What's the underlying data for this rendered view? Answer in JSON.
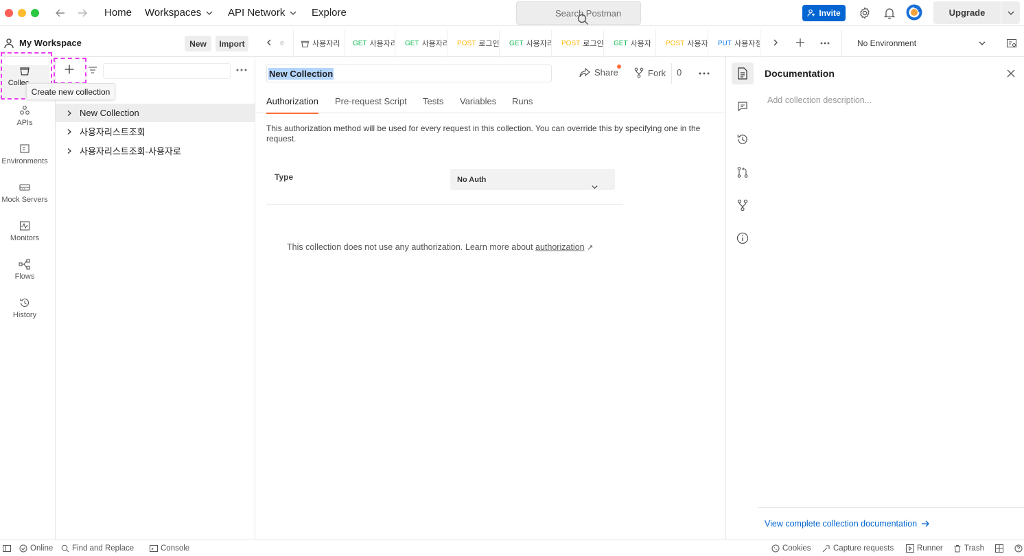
{
  "window": {
    "nav": {
      "home": "Home",
      "workspaces": "Workspaces",
      "api_network": "API Network",
      "explore": "Explore"
    },
    "search_placeholder": "Search Postman",
    "invite_label": "Invite",
    "upgrade_label": "Upgrade"
  },
  "sidebar": {
    "workspace_name": "My Workspace",
    "new_label": "New",
    "import_label": "Import",
    "rail": [
      {
        "label": "Collections",
        "visible_label": "Collec",
        "icon": "collections-icon"
      },
      {
        "label": "APIs",
        "icon": "apis-icon"
      },
      {
        "label": "Environments",
        "icon": "environments-icon"
      },
      {
        "label": "Mock Servers",
        "icon": "mock-servers-icon"
      },
      {
        "label": "Monitors",
        "icon": "monitors-icon"
      },
      {
        "label": "Flows",
        "icon": "flows-icon"
      },
      {
        "label": "History",
        "icon": "history-icon"
      }
    ],
    "tooltip": "Create new collection",
    "collections": [
      {
        "name": "New Collection",
        "selected": true
      },
      {
        "name": "사용자리스트조회"
      },
      {
        "name": "사용자리스트조회-사용자로"
      }
    ]
  },
  "tabs": [
    {
      "method": "",
      "name": "e",
      "kind": "fragment"
    },
    {
      "method": "",
      "name": "사용자리",
      "kind": "collection"
    },
    {
      "method": "GET",
      "name": "사용자리"
    },
    {
      "method": "GET",
      "name": "사용자리"
    },
    {
      "method": "POST",
      "name": "로그인"
    },
    {
      "method": "GET",
      "name": "사용자리"
    },
    {
      "method": "POST",
      "name": "로그인"
    },
    {
      "method": "GET",
      "name": "사용자",
      "unsaved": true
    },
    {
      "method": "POST",
      "name": "사용자"
    },
    {
      "method": "PUT",
      "name": "사용자정"
    }
  ],
  "environment": {
    "selected": "No Environment"
  },
  "collection": {
    "name": "New Collection",
    "share_label": "Share",
    "fork_label": "Fork",
    "fork_count": "0",
    "subtabs": [
      "Authorization",
      "Pre-request Script",
      "Tests",
      "Variables",
      "Runs"
    ],
    "active_subtab": "Authorization",
    "auth_info": "This authorization method will be used for every request in this collection. You can override this by specifying one in the request.",
    "type_label": "Type",
    "type_value": "No Auth",
    "noauth_text": "This collection does not use any authorization. Learn more about ",
    "noauth_link": "authorization",
    "noauth_arrow": "↗"
  },
  "docs": {
    "title": "Documentation",
    "placeholder": "Add collection description...",
    "view_link": "View complete collection documentation"
  },
  "statusbar": {
    "online": "Online",
    "find_replace": "Find and Replace",
    "console": "Console",
    "cookies": "Cookies",
    "capture": "Capture requests",
    "runner": "Runner",
    "trash": "Trash"
  },
  "colors": {
    "accent": "#ff6c37",
    "invite_blue": "#0265d2",
    "get": "#0cbb52",
    "post": "#ffb400",
    "put": "#097bed",
    "highlight": "#e83cf0"
  }
}
